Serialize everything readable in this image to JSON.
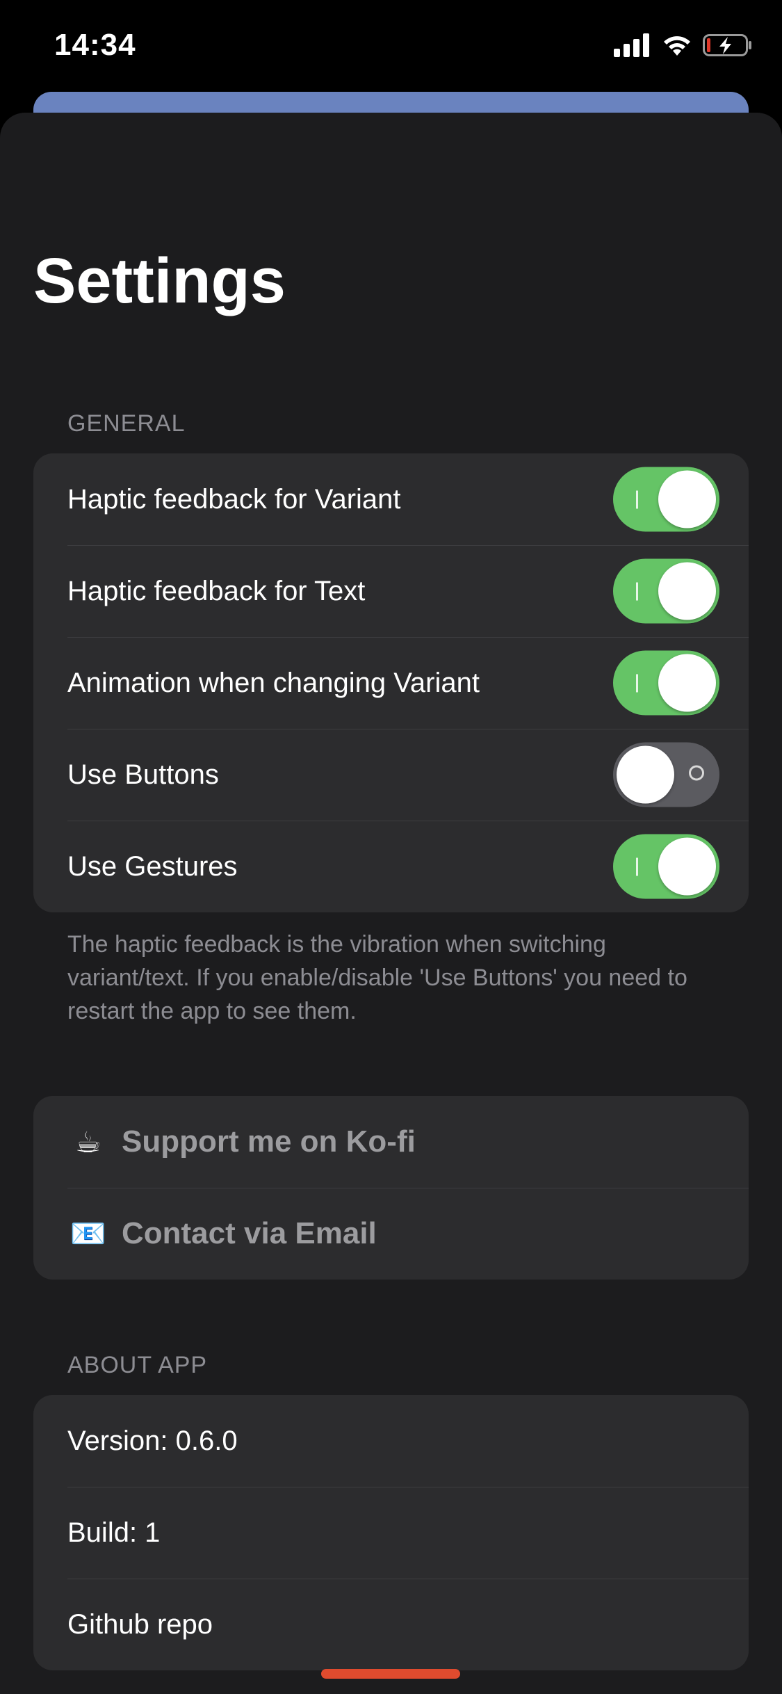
{
  "status_bar": {
    "time": "14:34"
  },
  "header": {
    "title": "Settings"
  },
  "general": {
    "header": "GENERAL",
    "rows": [
      {
        "label": "Haptic feedback for Variant",
        "enabled": true
      },
      {
        "label": "Haptic feedback for Text",
        "enabled": true
      },
      {
        "label": "Animation when changing Variant",
        "enabled": true
      },
      {
        "label": "Use Buttons",
        "enabled": false
      },
      {
        "label": "Use Gestures",
        "enabled": true
      }
    ],
    "footer": "The haptic feedback is the vibration when switching variant/text. If you enable/disable 'Use Buttons' you need to restart the app to see them."
  },
  "links": {
    "items": [
      {
        "emoji": "☕",
        "label": "Support me on Ko-fi"
      },
      {
        "emoji": "📧",
        "label": "Contact via Email"
      }
    ]
  },
  "about": {
    "header": "ABOUT APP",
    "items": [
      {
        "label": "Version: 0.6.0"
      },
      {
        "label": "Build: 1"
      },
      {
        "label": "Github repo"
      }
    ]
  },
  "colors": {
    "toggle_on": "#65c466",
    "toggle_off": "#5b5b60",
    "accent_bar": "#6a83bf",
    "home_indicator": "#e04b2e"
  }
}
